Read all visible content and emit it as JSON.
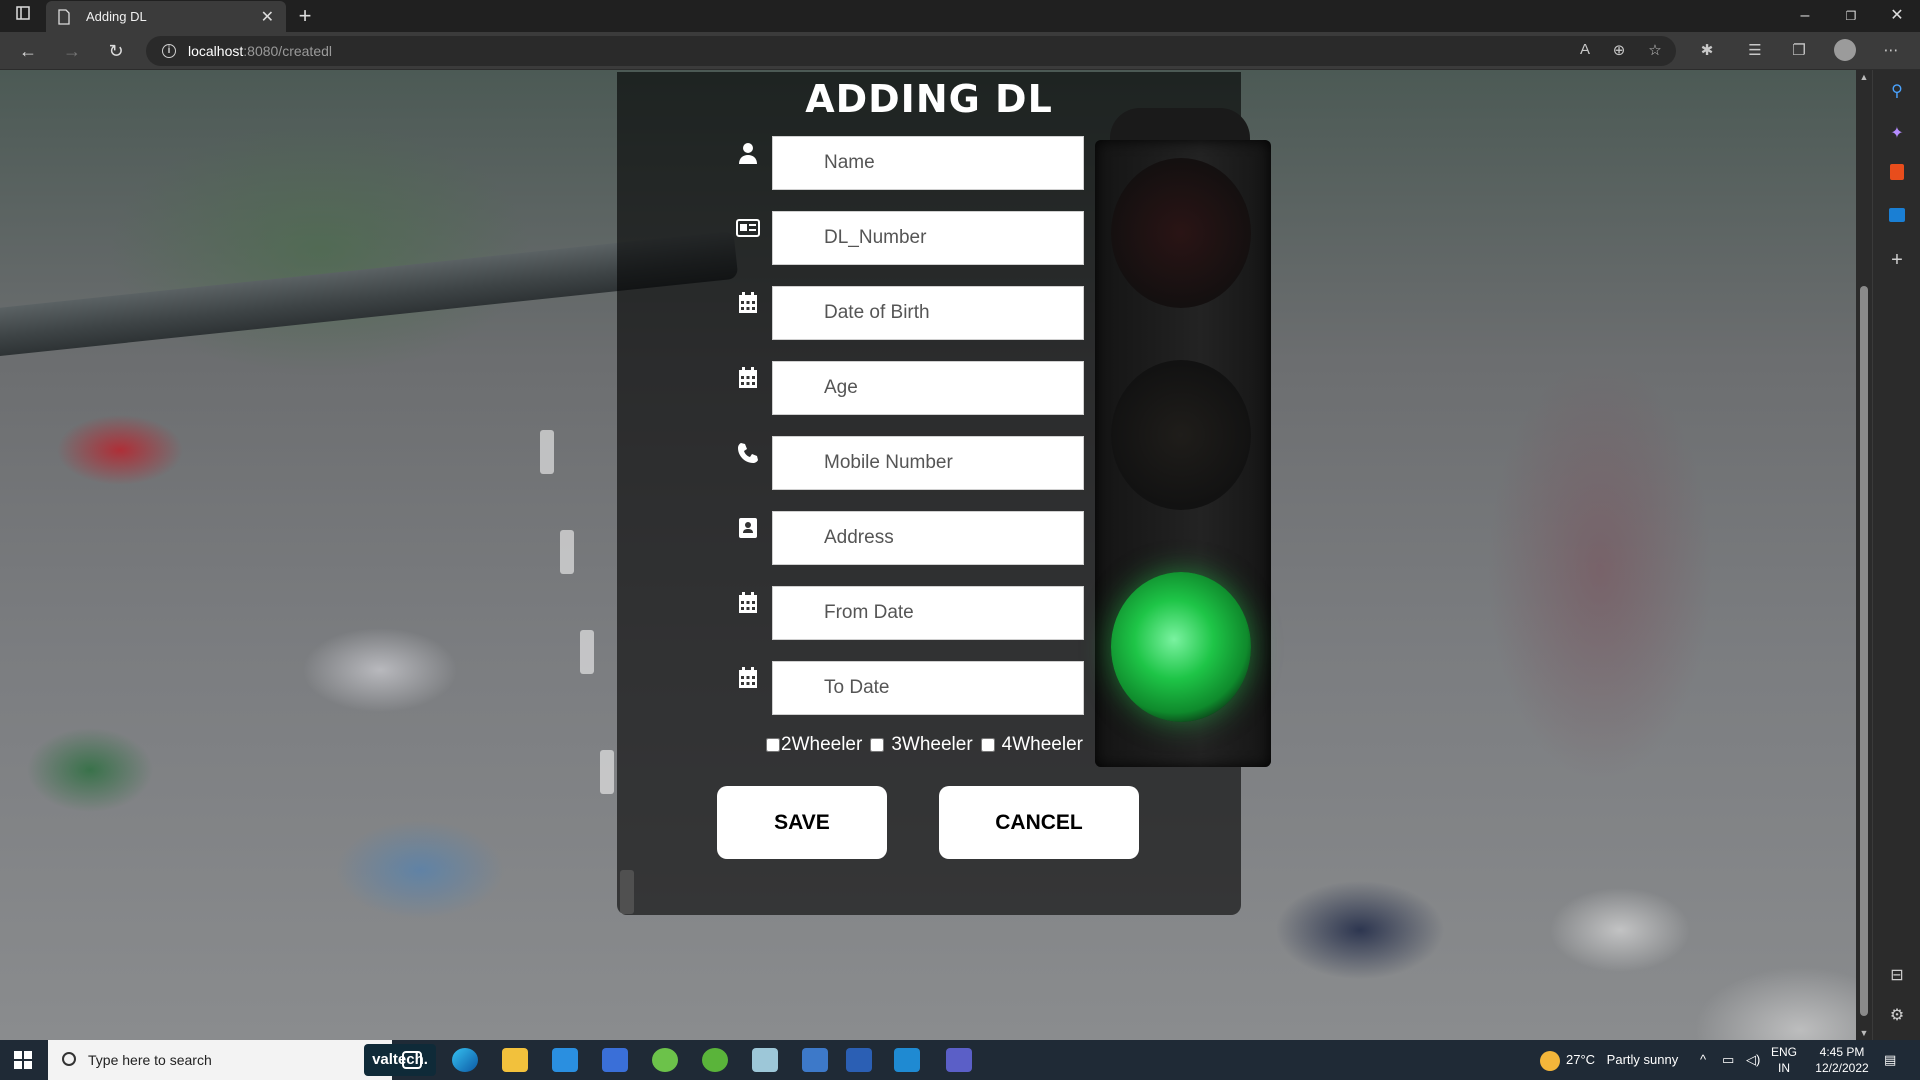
{
  "browser": {
    "tab_title": "Adding DL",
    "url_host": "localhost",
    "url_rest": ":8080/createdl",
    "tab_close_glyph": "✕",
    "new_tab_glyph": "+"
  },
  "form": {
    "title": "ADDING DL",
    "fields": [
      {
        "name": "name",
        "placeholder": "Name",
        "icon": "user-icon"
      },
      {
        "name": "dl_number",
        "placeholder": "DL_Number",
        "icon": "id-card-icon"
      },
      {
        "name": "dob",
        "placeholder": "Date of Birth",
        "icon": "calendar-icon"
      },
      {
        "name": "age",
        "placeholder": "Age",
        "icon": "calendar-icon"
      },
      {
        "name": "mobile",
        "placeholder": "Mobile Number",
        "icon": "phone-icon"
      },
      {
        "name": "address",
        "placeholder": "Address",
        "icon": "address-book-icon"
      },
      {
        "name": "from_date",
        "placeholder": "From Date",
        "icon": "calendar-icon"
      },
      {
        "name": "to_date",
        "placeholder": "To Date",
        "icon": "calendar-icon"
      }
    ],
    "vehicle_types": [
      "2Wheeler",
      "3Wheeler",
      "4Wheeler"
    ],
    "save_label": "SAVE",
    "cancel_label": "CANCEL"
  },
  "taskbar": {
    "search_placeholder": "Type here to search",
    "brand_label": "valtech.",
    "weather_temp": "27°C",
    "weather_text": "Partly sunny",
    "lang_line1": "ENG",
    "lang_line2": "IN",
    "time": "4:45 PM",
    "date": "12/2/2022"
  },
  "colors": {
    "panel_overlay": "#000000",
    "traffic_light_green": "#1ec547",
    "taskbar": "#1f2a36"
  }
}
